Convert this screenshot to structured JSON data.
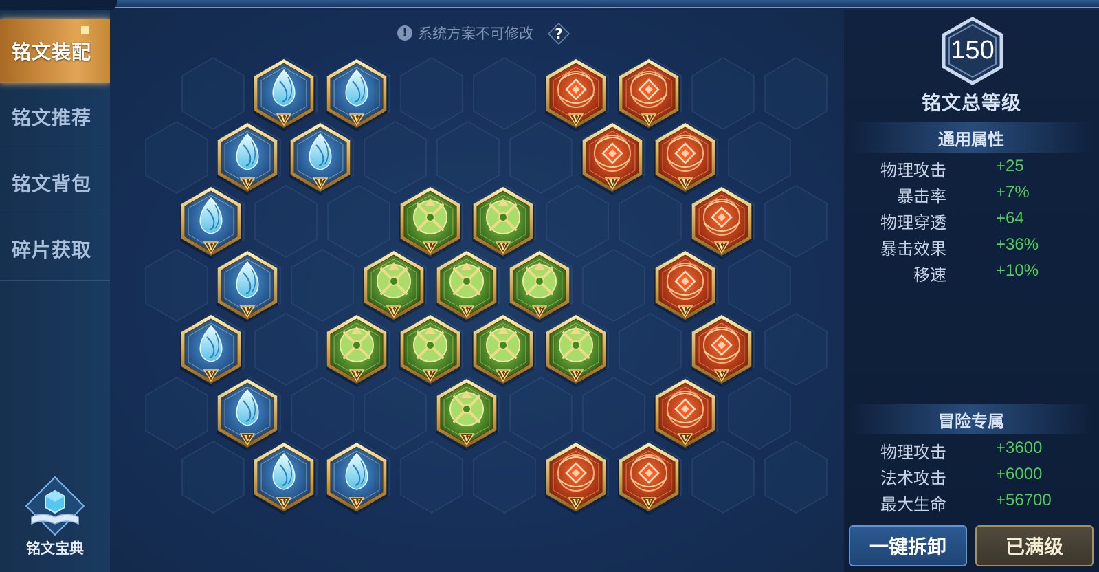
{
  "sidebar": {
    "items": [
      {
        "label": "铭文装配",
        "active": true
      },
      {
        "label": "铭文推荐",
        "active": false
      },
      {
        "label": "铭文背包",
        "active": false
      },
      {
        "label": "碎片获取",
        "active": false
      }
    ],
    "codex_label": "铭文宝典"
  },
  "board": {
    "notice": "系统方案不可修改",
    "help_icon": "?",
    "rune_types": {
      "blue": {
        "icon": "water-drop-rune-icon",
        "color": "#2d6fb0",
        "tier": "V"
      },
      "green": {
        "icon": "clover-rune-icon",
        "color": "#3f8f2c",
        "tier": "V"
      },
      "red": {
        "icon": "rose-rune-icon",
        "color": "#c0401a",
        "tier": "V"
      }
    },
    "rune_counts": {
      "blue": 10,
      "green": 10,
      "red": 10
    }
  },
  "panel": {
    "level": "150",
    "level_label": "铭文总等级",
    "general_title": "通用属性",
    "general_stats": [
      {
        "name": "物理攻击",
        "value": "+25"
      },
      {
        "name": "暴击率",
        "value": "+7%"
      },
      {
        "name": "物理穿透",
        "value": "+64"
      },
      {
        "name": "暴击效果",
        "value": "+36%"
      },
      {
        "name": "移速",
        "value": "+10%"
      }
    ],
    "adventure_title": "冒险专属",
    "adventure_stats": [
      {
        "name": "物理攻击",
        "value": "+3600"
      },
      {
        "name": "法术攻击",
        "value": "+6000"
      },
      {
        "name": "最大生命",
        "value": "+56700"
      }
    ],
    "stat_value_color": "#4fcf58"
  },
  "buttons": {
    "unload": "一键拆卸",
    "maxed": "已满级"
  }
}
